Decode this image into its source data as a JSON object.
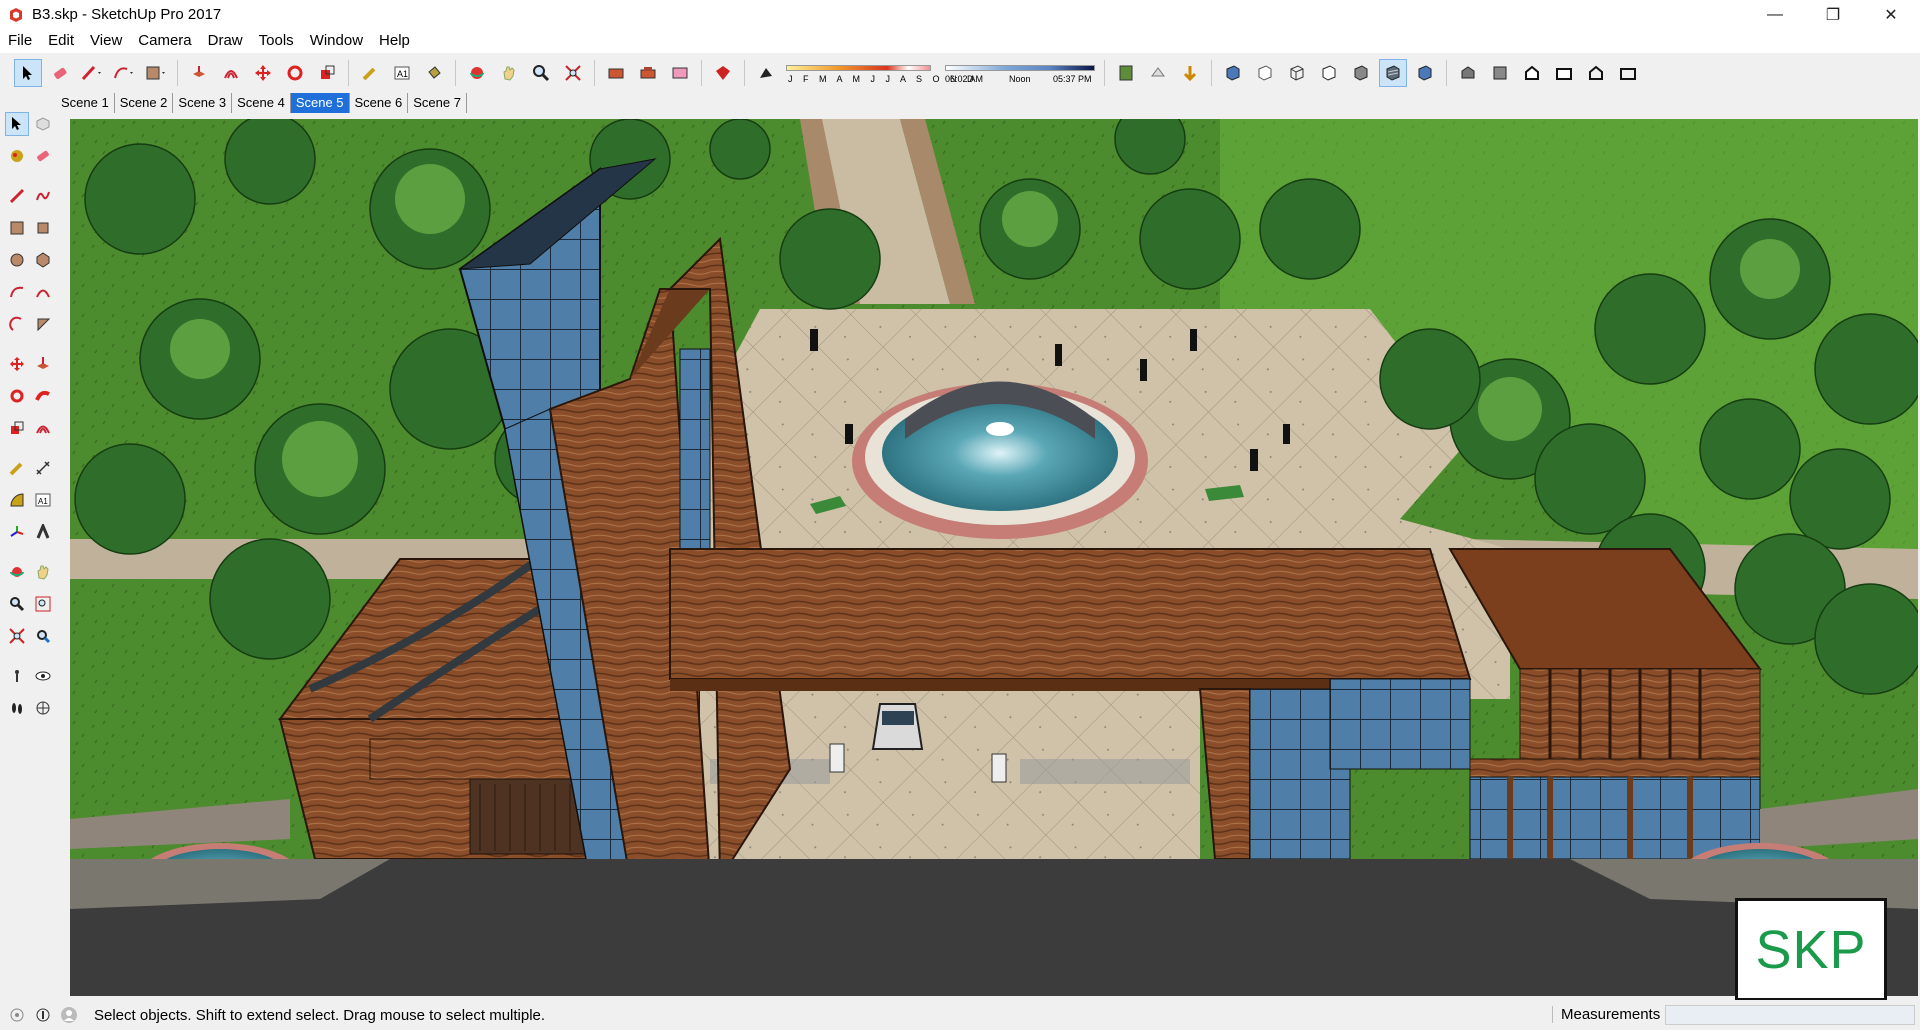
{
  "window": {
    "title": "B3.skp - SketchUp Pro 2017",
    "icons": [
      "sketchup-app-icon",
      "minimize-icon",
      "maximize-icon",
      "close-icon"
    ]
  },
  "menu": {
    "items": [
      "File",
      "Edit",
      "View",
      "Camera",
      "Draw",
      "Tools",
      "Window",
      "Help"
    ]
  },
  "toolbar": {
    "shadow_months": "J F M A M J J A S O N D",
    "time_start": "06:02 AM",
    "time_noon": "Noon",
    "time_end": "05:37 PM"
  },
  "scenes": {
    "tabs": [
      "Scene 1",
      "Scene 2",
      "Scene 3",
      "Scene 4",
      "Scene 5",
      "Scene 6",
      "Scene 7"
    ],
    "active": "Scene 5"
  },
  "status": {
    "hint": "Select objects. Shift to extend select. Drag mouse to select multiple.",
    "measurements_label": "Measurements",
    "measurements_value": ""
  },
  "watermark": {
    "text": "SKP"
  },
  "colors": {
    "active_tab": "#1e6fd9",
    "grass": "#5a9a3a",
    "wood": "#8a4f2a",
    "watermark_green": "#1c9a4b"
  }
}
